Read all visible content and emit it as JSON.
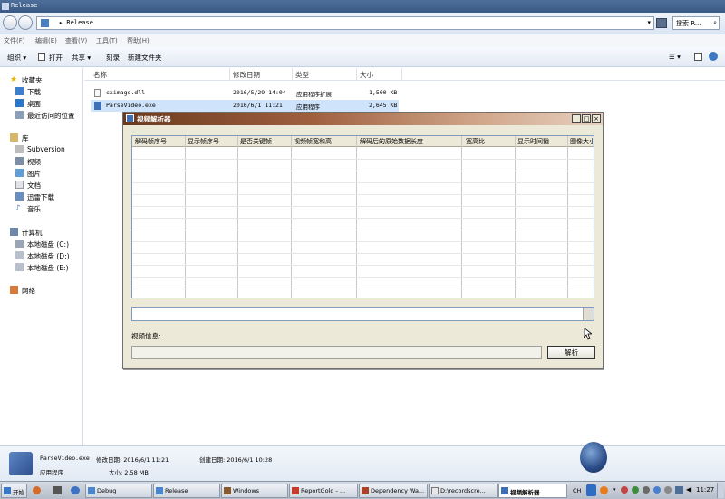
{
  "window": {
    "title": "Release"
  },
  "address": {
    "path": "▸ Release",
    "search_placeholder": "搜索 R..."
  },
  "menu": [
    "文件(F)",
    "编辑(E)",
    "查看(V)",
    "工具(T)",
    "帮助(H)"
  ],
  "toolbar": {
    "organize": "组织 ▾",
    "open": "打开",
    "share": "共享 ▾",
    "burn": "刻录",
    "new_folder": "新建文件夹",
    "views": "☰ ▾"
  },
  "sidebar": {
    "favorites": "收藏夹",
    "fav_items": [
      "下载",
      "桌面",
      "最近访问的位置"
    ],
    "libraries": "库",
    "lib_items": [
      "Subversion",
      "视频",
      "图片",
      "文档",
      "迅雷下载",
      "音乐"
    ],
    "computer": "计算机",
    "drives": [
      "本地磁盘 (C:)",
      "本地磁盘 (D:)",
      "本地磁盘 (E:)"
    ],
    "network": "网络"
  },
  "columns": {
    "name": "名称",
    "modified": "修改日期",
    "type": "类型",
    "size": "大小"
  },
  "files": [
    {
      "name": "cximage.dll",
      "date": "2016/5/29 14:04",
      "type": "应用程序扩展",
      "size": "1,500 KB"
    },
    {
      "name": "ParseVideo.exe",
      "date": "2016/6/1 11:21",
      "type": "应用程序",
      "size": "2,645 KB"
    }
  ],
  "dialog": {
    "title": "视频解析器",
    "columns": [
      "解码帧序号",
      "显示帧序号",
      "是否关键帧",
      "视频帧宽和高",
      "解码后的原始数据长度",
      "宽高比",
      "显示时间戳",
      "图像大小"
    ],
    "info_label": "视频信息:",
    "parse_button": "解析"
  },
  "details": {
    "name": "ParseVideo.exe",
    "modified": "修改日期: 2016/6/1 11:21",
    "created": "创建日期: 2016/6/1 10:28",
    "type": "应用程序",
    "size": "大小: 2.58 MB"
  },
  "taskbar": {
    "start": "开始",
    "items": [
      "Debug",
      "Release",
      "Windows",
      "ReportGold - ...",
      "Dependency Wa...",
      "D:\\recordscre...",
      "视频解析器"
    ],
    "tray_text": "CH",
    "clock": "11:27"
  }
}
